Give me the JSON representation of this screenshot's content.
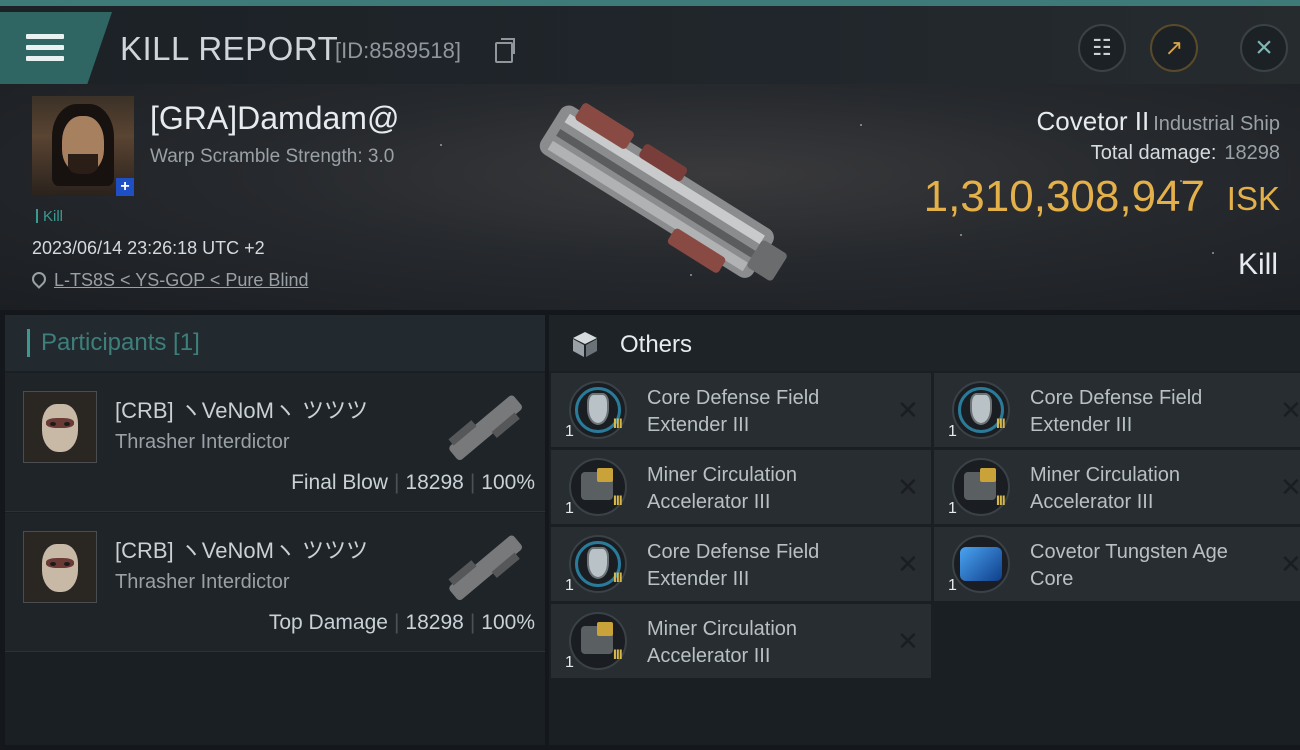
{
  "header": {
    "title": "KILL REPORT",
    "report_id": "[ID:8589518]"
  },
  "victim": {
    "name": "[GRA]Damdam@",
    "warp_scramble": "Warp Scramble Strength: 3.0",
    "kill_tag": "Kill",
    "datetime": "2023/06/14 23:26:18 UTC +2",
    "location": "L-TS8S < YS-GOP < Pure Blind"
  },
  "ship": {
    "name": "Covetor II",
    "class": "Industrial Ship",
    "total_damage_label": "Total damage:",
    "total_damage": "18298",
    "isk_value": "1,310,308,947",
    "isk_unit": "ISK",
    "result": "Kill"
  },
  "participants": {
    "title": "Participants [1]",
    "rows": [
      {
        "name": "[CRB] ヽVeNoMヽ ツツツ",
        "ship": "Thrasher Interdictor",
        "role": "Final Blow",
        "damage": "18298",
        "percent": "100%"
      },
      {
        "name": "[CRB] ヽVeNoMヽ ツツツ",
        "ship": "Thrasher Interdictor",
        "role": "Top Damage",
        "damage": "18298",
        "percent": "100%"
      }
    ]
  },
  "others": {
    "title": "Others",
    "items": [
      {
        "name": "Core Defense Field Extender III",
        "qty": "1",
        "tier": "III",
        "icon": "shield-extender-icon"
      },
      {
        "name": "Core Defense Field Extender III",
        "qty": "1",
        "tier": "III",
        "icon": "shield-extender-icon"
      },
      {
        "name": "Miner Circulation Accelerator III",
        "qty": "1",
        "tier": "III",
        "icon": "miner-accelerator-icon"
      },
      {
        "name": "Miner Circulation Accelerator III",
        "qty": "1",
        "tier": "III",
        "icon": "miner-accelerator-icon"
      },
      {
        "name": "Core Defense Field Extender III",
        "qty": "1",
        "tier": "III",
        "icon": "shield-extender-icon"
      },
      {
        "name": "Covetor Tungsten Age Core",
        "qty": "1",
        "tier": "",
        "icon": "tungsten-core-icon"
      },
      {
        "name": "Miner Circulation Accelerator III",
        "qty": "1",
        "tier": "III",
        "icon": "miner-accelerator-icon"
      }
    ]
  },
  "colors": {
    "accent": "#3e7a78",
    "isk": "#e4b04a",
    "teal_text": "#3d7f7b"
  }
}
